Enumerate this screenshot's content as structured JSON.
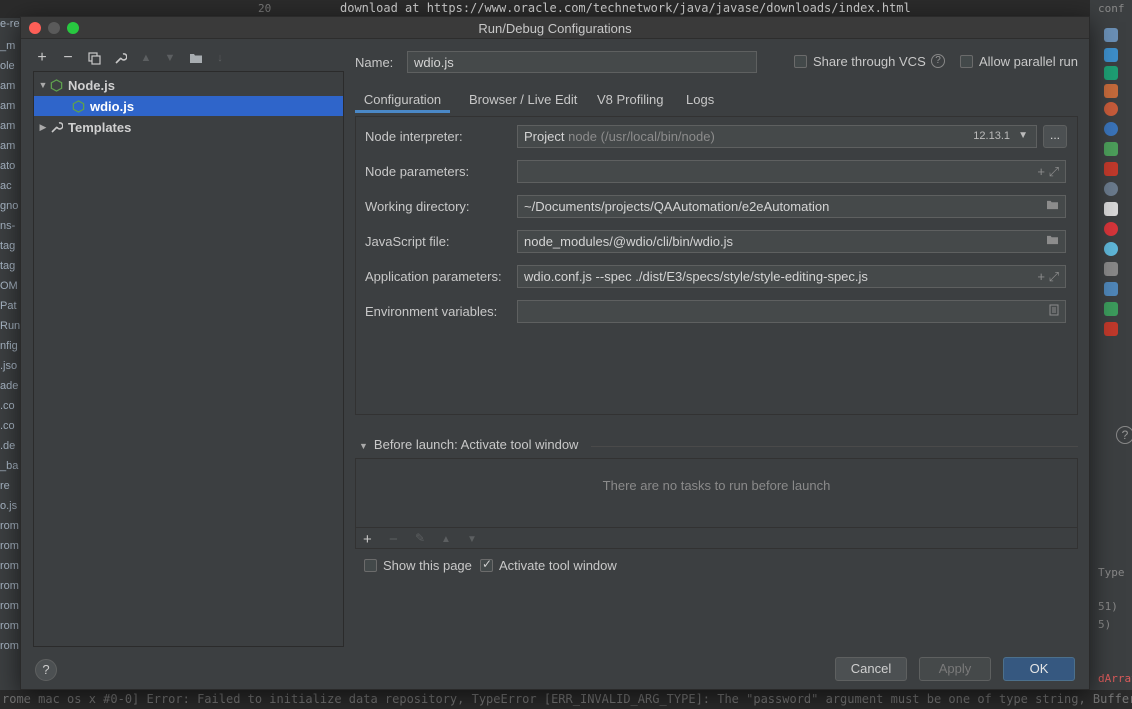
{
  "background": {
    "editor_line_number": "20",
    "editor_line": "download at https://www.oracle.com/technetwork/java/javase/downloads/index.html",
    "bottom_line": "rome  mac os x #0-0] Error: Failed to initialize data repository, TypeError [ERR_INVALID_ARG_TYPE]: The \"password\" argument must be one of type string, Buffer, Typ",
    "left_fragments": [
      "e-results",
      "_m",
      "ole",
      "am",
      "am",
      "am",
      "am",
      "ato",
      "ac",
      "gno",
      "ns-",
      "tag",
      "tag",
      "OM",
      "Pat",
      "Run",
      "nfig",
      ".jso",
      "ade",
      ".co",
      ".co",
      ".de",
      "_ba",
      "re",
      "o.js",
      "rom",
      "rom",
      "rom",
      "rom",
      "rom",
      "rom",
      "rom"
    ],
    "right_fragments": [
      "conf",
      "Type",
      "51)",
      "5)",
      "dArray"
    ]
  },
  "dialog": {
    "title": "Run/Debug Configurations",
    "tree": {
      "items": [
        {
          "label": "Node.js",
          "expanded": true
        },
        {
          "label": "wdio.js",
          "selected": true
        },
        {
          "label": "Templates",
          "expanded": false
        }
      ]
    },
    "name_label": "Name:",
    "name_value": "wdio.js",
    "share_vcs_label": "Share through VCS",
    "share_vcs_checked": false,
    "parallel_label": "Allow parallel run",
    "parallel_checked": false,
    "tabs": [
      "Configuration",
      "Browser / Live Edit",
      "V8 Profiling",
      "Logs"
    ],
    "active_tab": "Configuration",
    "fields": {
      "node_interpreter": {
        "label": "Node interpreter:",
        "value": "Project",
        "hint": "node (/usr/local/bin/node)",
        "version": "12.13.1"
      },
      "node_parameters": {
        "label": "Node parameters:",
        "value": ""
      },
      "working_directory": {
        "label": "Working directory:",
        "value": "~/Documents/projects/QAAutomation/e2eAutomation"
      },
      "javascript_file": {
        "label": "JavaScript file:",
        "value": "node_modules/@wdio/cli/bin/wdio.js"
      },
      "application_parameters": {
        "label": "Application parameters:",
        "value": "wdio.conf.js --spec ./dist/E3/specs/style/style-editing-spec.js"
      },
      "environment_variables": {
        "label": "Environment variables:",
        "value": ""
      }
    },
    "browse_button": "...",
    "before_launch": {
      "title": "Before launch: Activate tool window",
      "empty_text": "There are no tasks to run before launch"
    },
    "show_page_label": "Show this page",
    "show_page_checked": false,
    "activate_tool_label": "Activate tool window",
    "activate_tool_checked": true,
    "buttons": {
      "cancel": "Cancel",
      "apply": "Apply",
      "ok": "OK"
    },
    "colors": {
      "accent": "#2f65ca",
      "primary_button": "#365880",
      "close": "#fe5f57",
      "minimize": "#febc2e",
      "zoom": "#28c840"
    }
  }
}
